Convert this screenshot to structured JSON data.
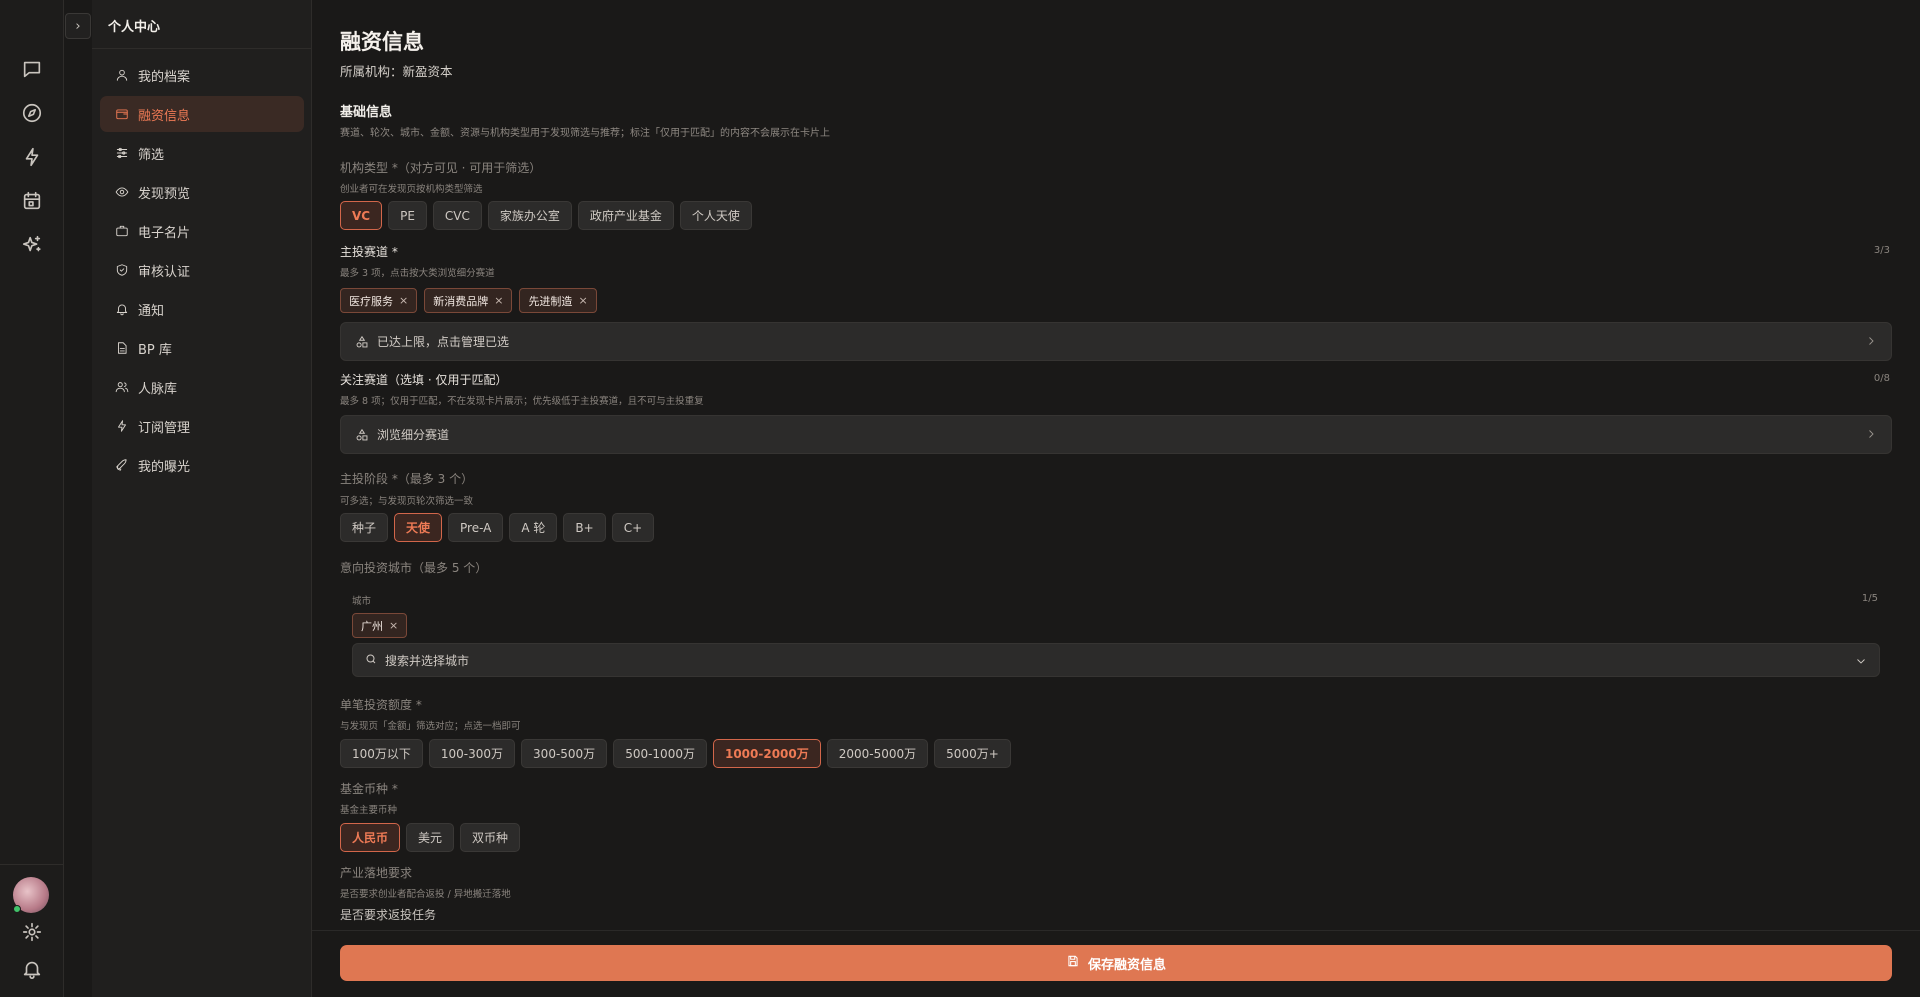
{
  "sidebar": {
    "title": "个人中心",
    "items": [
      {
        "label": "我的档案",
        "icon": "user-icon"
      },
      {
        "label": "融资信息",
        "icon": "wallet-icon"
      },
      {
        "label": "筛选",
        "icon": "sliders-icon"
      },
      {
        "label": "发现预览",
        "icon": "eye-icon"
      },
      {
        "label": "电子名片",
        "icon": "briefcase-icon"
      },
      {
        "label": "审核认证",
        "icon": "shield-check-icon"
      },
      {
        "label": "通知",
        "icon": "bell-icon"
      },
      {
        "label": "BP 库",
        "icon": "file-icon"
      },
      {
        "label": "人脉库",
        "icon": "users-icon"
      },
      {
        "label": "订阅管理",
        "icon": "bolt-icon"
      },
      {
        "label": "我的曝光",
        "icon": "rocket-icon"
      }
    ],
    "active_index": 1
  },
  "rail": {
    "icons": [
      "chat-icon",
      "compass-icon",
      "bolt-icon",
      "calendar-icon",
      "sparkle-icon"
    ],
    "bottom_icons": [
      "avatar",
      "gear-icon",
      "bell-icon"
    ]
  },
  "page": {
    "title": "融资信息",
    "subtitle": "所属机构：新盈资本"
  },
  "basic": {
    "title": "基础信息",
    "desc": "赛道、轮次、城市、金额、资源与机构类型用于发现筛选与推荐；标注「仅用于匹配」的内容不会展示在卡片上"
  },
  "org_type": {
    "label": "机构类型 *（对方可见 · 可用于筛选）",
    "hint": "创业者可在发现页按机构类型筛选",
    "options": [
      "VC",
      "PE",
      "CVC",
      "家族办公室",
      "政府产业基金",
      "个人天使"
    ],
    "selected": "VC"
  },
  "main_track": {
    "label": "主投赛道 *",
    "hint": "最多 3 项，点击按大类浏览细分赛道",
    "counter": "3/3",
    "tags": [
      "医疗服务",
      "新消费品牌",
      "先进制造"
    ],
    "nav_text": "已达上限，点击管理已选"
  },
  "focus_track": {
    "label": "关注赛道（选填 · 仅用于匹配）",
    "hint": "最多 8 项；仅用于匹配，不在发现卡片展示；优先级低于主投赛道，且不可与主投重复",
    "counter": "0/8",
    "nav_text": "浏览细分赛道"
  },
  "stage": {
    "label": "主投阶段 *（最多 3 个）",
    "hint": "可多选；与发现页轮次筛选一致",
    "options": [
      "种子",
      "天使",
      "Pre-A",
      "A 轮",
      "B+",
      "C+"
    ],
    "selected": "天使"
  },
  "city": {
    "label": "意向投资城市（最多 5 个）",
    "inner_label": "城市",
    "counter": "1/5",
    "tags": [
      "广州"
    ],
    "search_placeholder": "搜索并选择城市"
  },
  "amount": {
    "label": "单笔投资额度 *",
    "hint": "与发现页「金额」筛选对应；点选一档即可",
    "options": [
      "100万以下",
      "100-300万",
      "300-500万",
      "500-1000万",
      "1000-2000万",
      "2000-5000万",
      "5000万+"
    ],
    "selected": "1000-2000万"
  },
  "currency": {
    "label": "基金币种 *",
    "hint": "基金主要币种",
    "options": [
      "人民币",
      "美元",
      "双币种"
    ],
    "selected": "人民币"
  },
  "industry": {
    "label": "产业落地要求",
    "hint": "是否要求创业者配合返投 / 异地搬迁落地",
    "question": "是否要求返投任务"
  },
  "save_label": "保存融资信息",
  "colors": {
    "accent": "#df7752",
    "accent_text": "#ee7a55",
    "background": "#1a1918"
  }
}
